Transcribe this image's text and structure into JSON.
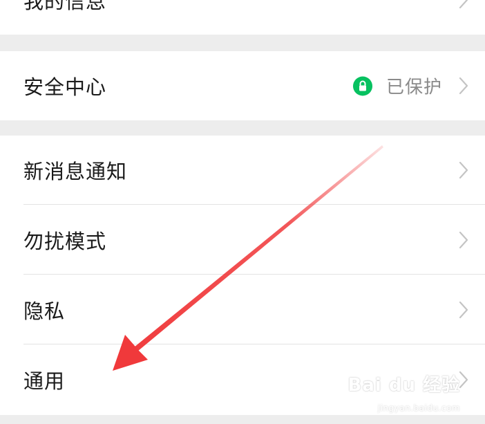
{
  "settings": {
    "top_partial_label": "我的信息",
    "security_center": {
      "label": "安全中心",
      "status_text": "已保护",
      "status_icon": "lock-icon",
      "status_color": "#07c160"
    },
    "items": [
      {
        "label": "新消息通知"
      },
      {
        "label": "勿扰模式"
      },
      {
        "label": "隐私"
      },
      {
        "label": "通用"
      }
    ]
  },
  "annotation": {
    "arrow_color": "#f0393b"
  },
  "watermark": {
    "text": "Bai du 经验",
    "sub_text": "jingyan.baidu.com"
  }
}
